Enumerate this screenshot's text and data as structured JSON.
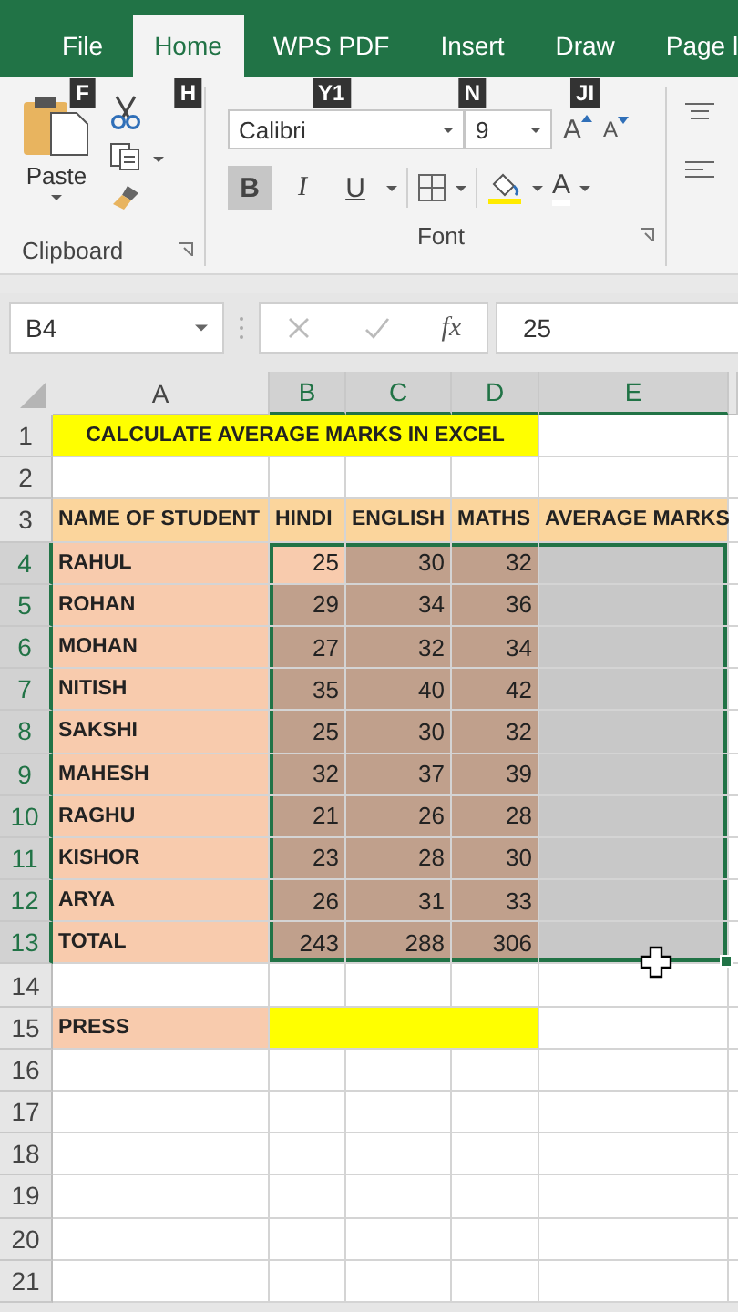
{
  "ribbon": {
    "tabs": [
      {
        "label": "File",
        "selected": false,
        "keytip": "F"
      },
      {
        "label": "Home",
        "selected": true,
        "keytip": "H"
      },
      {
        "label": "WPS PDF",
        "selected": false,
        "keytip": "Y1"
      },
      {
        "label": "Insert",
        "selected": false,
        "keytip": "N"
      },
      {
        "label": "Draw",
        "selected": false,
        "keytip": "JI"
      },
      {
        "label": "Page l",
        "selected": false
      }
    ],
    "clipboard": {
      "paste_label": "Paste",
      "group_label": "Clipboard"
    },
    "font": {
      "font_name": "Calibri",
      "font_size": "9",
      "grow_label": "A",
      "shrink_label": "A",
      "styles": [
        {
          "label": "B",
          "kind": "bold",
          "pressed": true
        },
        {
          "label": "I",
          "kind": "italic",
          "pressed": false
        },
        {
          "label": "U",
          "kind": "underline",
          "pressed": false
        }
      ],
      "font_color_label": "A",
      "group_label": "Font"
    }
  },
  "formula_bar": {
    "name_box": "B4",
    "function_label": "fx",
    "value": "25"
  },
  "sheet": {
    "columns": [
      {
        "label": "A",
        "selected": false
      },
      {
        "label": "B",
        "selected": true
      },
      {
        "label": "C",
        "selected": true
      },
      {
        "label": "D",
        "selected": true
      },
      {
        "label": "E",
        "selected": true
      }
    ],
    "rows": [
      {
        "number": "1",
        "selected": false,
        "cells": [
          {
            "text": "CALCULATE AVERAGE MARKS IN EXCEL",
            "color": "#ffff00",
            "kind": "title"
          },
          {
            "color": "#ffff00"
          },
          {
            "color": "#ffff00"
          },
          {
            "color": "#ffff00"
          },
          {}
        ]
      },
      {
        "number": "2",
        "selected": false,
        "cells": [
          {},
          {},
          {},
          {},
          {}
        ]
      },
      {
        "number": "3",
        "selected": false,
        "cells": [
          {
            "text": "NAME OF STUDENT",
            "color": "#fbd59c",
            "kind": "text"
          },
          {
            "text": "HINDI",
            "color": "#fbd59c",
            "kind": "text"
          },
          {
            "text": "ENGLISH",
            "color": "#fbd59c",
            "kind": "text"
          },
          {
            "text": "MATHS",
            "color": "#fbd59c",
            "kind": "text"
          },
          {
            "text": "AVERAGE MARKS",
            "color": "#fbd59c",
            "kind": "text"
          }
        ]
      },
      {
        "number": "4",
        "selected": true,
        "cells": [
          {
            "text": "RAHUL",
            "color": "#f8cbad",
            "kind": "text"
          },
          {
            "text": "25",
            "color": "#f8cbad",
            "kind": "number",
            "active": true
          },
          {
            "text": "30",
            "color": "#c0a08c",
            "kind": "number"
          },
          {
            "text": "32",
            "color": "#c0a08c",
            "kind": "number"
          },
          {}
        ]
      },
      {
        "number": "5",
        "selected": true,
        "cells": [
          {
            "text": "ROHAN",
            "color": "#f8cbad",
            "kind": "text"
          },
          {
            "text": "29",
            "color": "#c0a08c",
            "kind": "number"
          },
          {
            "text": "34",
            "color": "#c0a08c",
            "kind": "number"
          },
          {
            "text": "36",
            "color": "#c0a08c",
            "kind": "number"
          },
          {}
        ]
      },
      {
        "number": "6",
        "selected": true,
        "cells": [
          {
            "text": "MOHAN",
            "color": "#f8cbad",
            "kind": "text"
          },
          {
            "text": "27",
            "color": "#c0a08c",
            "kind": "number"
          },
          {
            "text": "32",
            "color": "#c0a08c",
            "kind": "number"
          },
          {
            "text": "34",
            "color": "#c0a08c",
            "kind": "number"
          },
          {}
        ]
      },
      {
        "number": "7",
        "selected": true,
        "cells": [
          {
            "text": "NITISH",
            "color": "#f8cbad",
            "kind": "text"
          },
          {
            "text": "35",
            "color": "#c0a08c",
            "kind": "number"
          },
          {
            "text": "40",
            "color": "#c0a08c",
            "kind": "number"
          },
          {
            "text": "42",
            "color": "#c0a08c",
            "kind": "number"
          },
          {}
        ]
      },
      {
        "number": "8",
        "selected": true,
        "cells": [
          {
            "text": "SAKSHI",
            "color": "#f8cbad",
            "kind": "text"
          },
          {
            "text": "25",
            "color": "#c0a08c",
            "kind": "number"
          },
          {
            "text": "30",
            "color": "#c0a08c",
            "kind": "number"
          },
          {
            "text": "32",
            "color": "#c0a08c",
            "kind": "number"
          },
          {}
        ]
      },
      {
        "number": "9",
        "selected": true,
        "cells": [
          {
            "text": "MAHESH",
            "color": "#f8cbad",
            "kind": "text"
          },
          {
            "text": "32",
            "color": "#c0a08c",
            "kind": "number"
          },
          {
            "text": "37",
            "color": "#c0a08c",
            "kind": "number"
          },
          {
            "text": "39",
            "color": "#c0a08c",
            "kind": "number"
          },
          {}
        ]
      },
      {
        "number": "10",
        "selected": true,
        "cells": [
          {
            "text": "RAGHU",
            "color": "#f8cbad",
            "kind": "text"
          },
          {
            "text": "21",
            "color": "#c0a08c",
            "kind": "number"
          },
          {
            "text": "26",
            "color": "#c0a08c",
            "kind": "number"
          },
          {
            "text": "28",
            "color": "#c0a08c",
            "kind": "number"
          },
          {}
        ]
      },
      {
        "number": "11",
        "selected": true,
        "cells": [
          {
            "text": "KISHOR",
            "color": "#f8cbad",
            "kind": "text"
          },
          {
            "text": "23",
            "color": "#c0a08c",
            "kind": "number"
          },
          {
            "text": "28",
            "color": "#c0a08c",
            "kind": "number"
          },
          {
            "text": "30",
            "color": "#c0a08c",
            "kind": "number"
          },
          {}
        ]
      },
      {
        "number": "12",
        "selected": true,
        "cells": [
          {
            "text": "ARYA",
            "color": "#f8cbad",
            "kind": "text"
          },
          {
            "text": "26",
            "color": "#c0a08c",
            "kind": "number"
          },
          {
            "text": "31",
            "color": "#c0a08c",
            "kind": "number"
          },
          {
            "text": "33",
            "color": "#c0a08c",
            "kind": "number"
          },
          {}
        ]
      },
      {
        "number": "13",
        "selected": true,
        "cells": [
          {
            "text": "TOTAL",
            "color": "#f8cbad",
            "kind": "text"
          },
          {
            "text": "243",
            "color": "#c0a08c",
            "kind": "number"
          },
          {
            "text": "288",
            "color": "#c0a08c",
            "kind": "number"
          },
          {
            "text": "306",
            "color": "#c0a08c",
            "kind": "number"
          },
          {}
        ]
      },
      {
        "number": "14",
        "selected": false,
        "cells": [
          {},
          {},
          {},
          {},
          {}
        ]
      },
      {
        "number": "15",
        "selected": false,
        "cells": [
          {
            "text": "PRESS",
            "color": "#f8cbad",
            "kind": "text"
          },
          {
            "color": "#ffff00"
          },
          {
            "color": "#ffff00"
          },
          {
            "color": "#ffff00"
          },
          {}
        ]
      },
      {
        "number": "16",
        "selected": false,
        "cells": [
          {},
          {},
          {},
          {},
          {}
        ]
      },
      {
        "number": "17",
        "selected": false,
        "cells": [
          {},
          {},
          {},
          {},
          {}
        ]
      },
      {
        "number": "18",
        "selected": false,
        "cells": [
          {},
          {},
          {},
          {},
          {}
        ]
      },
      {
        "number": "19",
        "selected": false,
        "cells": [
          {},
          {},
          {},
          {},
          {}
        ]
      },
      {
        "number": "20",
        "selected": false,
        "cells": [
          {},
          {},
          {},
          {},
          {}
        ]
      },
      {
        "number": "21",
        "selected": false,
        "cells": [
          {},
          {},
          {},
          {},
          {}
        ]
      }
    ]
  }
}
